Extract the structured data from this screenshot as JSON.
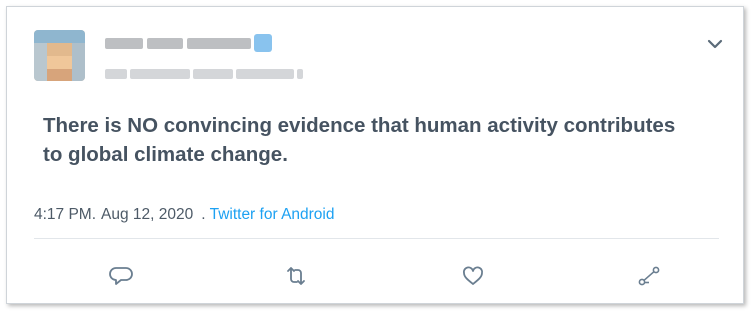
{
  "tweet": {
    "text": "There is NO convincing evidence that human activity contributes to global climate change.",
    "time": "4:17 PM.",
    "date": "Aug 12, 2020",
    "separator": ".",
    "source": "Twitter for Android"
  },
  "user": {
    "display_name_blurred": true,
    "handle_blurred": true,
    "verified": true
  },
  "icons": {
    "more": "chevron-down-icon",
    "reply": "reply-icon",
    "retweet": "retweet-icon",
    "like": "heart-icon",
    "share": "share-icon"
  },
  "colors": {
    "text": "#465361",
    "link": "#1da1f2",
    "icon": "#6a7e90"
  }
}
